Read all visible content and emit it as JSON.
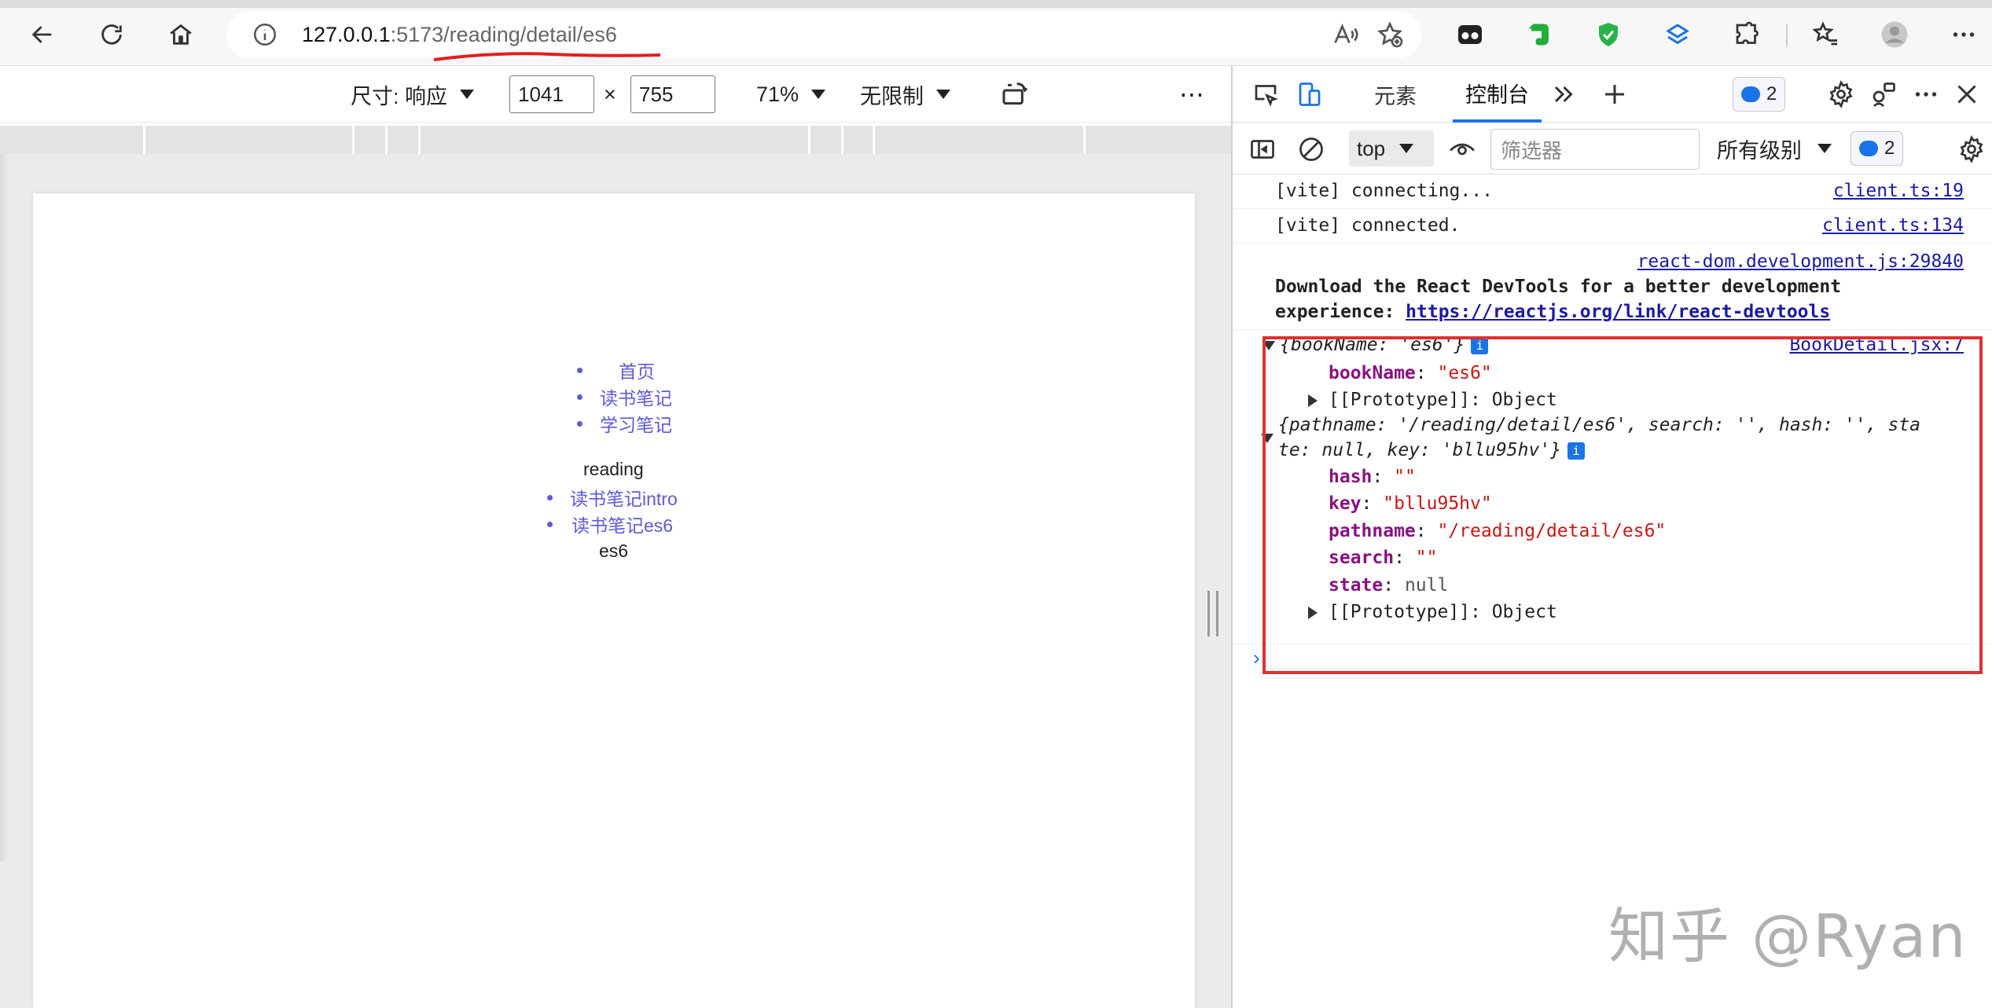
{
  "browser": {
    "url_host": "127.0.0.1",
    "url_rest": ":5173/reading/detail/es6"
  },
  "device_toolbar": {
    "dimensions_label": "尺寸: 响应",
    "width": "1041",
    "times": "×",
    "height": "755",
    "zoom": "71%",
    "throttle": "无限制",
    "more": "⋯"
  },
  "page": {
    "nav_top": [
      "首页",
      "读书笔记",
      "学习笔记"
    ],
    "section_title": "reading",
    "nav_reading": [
      "读书笔记intro",
      "读书笔记es6"
    ],
    "detail_text": "es6"
  },
  "devtools": {
    "tabs": [
      "元素",
      "控制台"
    ],
    "active_tab": "控制台",
    "issues_count": "2",
    "context": "top",
    "filter_placeholder": "筛选器",
    "levels_label": "所有级别",
    "messages_count": "2",
    "console": {
      "row1": {
        "text": "[vite] connecting...",
        "source": "client.ts:19"
      },
      "row2": {
        "text": "[vite] connected.",
        "source": "client.ts:134"
      },
      "row3": {
        "source": "react-dom.development.js:29840",
        "line1": "Download the React DevTools for a better development",
        "line2_prefix": "experience: ",
        "line2_link": "https://reactjs.org/link/react-devtools"
      },
      "obj1": {
        "summary": "{bookName: 'es6'}",
        "source": "BookDetail.jsx:7",
        "props": [
          {
            "key": "bookName",
            "value": "\"es6\""
          }
        ],
        "prototype": "[[Prototype]]: Object"
      },
      "obj2": {
        "summary_line1": "{pathname: '/reading/detail/es6', search: '', hash: '', sta",
        "summary_line2": "te: null, key: 'bllu95hv'}",
        "props": [
          {
            "key": "hash",
            "value": "\"\""
          },
          {
            "key": "key",
            "value": "\"bllu95hv\""
          },
          {
            "key": "pathname",
            "value": "\"/reading/detail/es6\""
          },
          {
            "key": "search",
            "value": "\"\""
          },
          {
            "key": "state",
            "value": "null"
          }
        ],
        "prototype": "[[Prototype]]: Object"
      },
      "prompt": "›"
    }
  },
  "watermark": "知乎 @Ryan",
  "colors": {
    "link": "#5b5bd6",
    "accent": "#1a73e8",
    "highlight_box": "#e03030"
  }
}
